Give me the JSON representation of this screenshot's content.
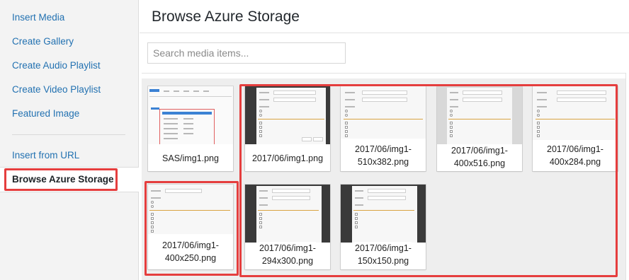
{
  "sidebar": {
    "items": [
      {
        "label": "Insert Media"
      },
      {
        "label": "Create Gallery"
      },
      {
        "label": "Create Audio Playlist"
      },
      {
        "label": "Create Video Playlist"
      },
      {
        "label": "Featured Image"
      }
    ],
    "secondary": [
      {
        "label": "Insert from URL"
      }
    ],
    "active": {
      "label": "Browse Azure Storage"
    }
  },
  "frame": {
    "title": "Browse Azure Storage",
    "search_placeholder": "Search media items..."
  },
  "media": [
    {
      "line1": "SAS/img1.png",
      "line2": ""
    },
    {
      "line1": "2017/06/img1.png",
      "line2": ""
    },
    {
      "line1": "2017/06/img1-",
      "line2": "510x382.png"
    },
    {
      "line1": "2017/06/img1-",
      "line2": "400x516.png"
    },
    {
      "line1": "2017/06/img1-",
      "line2": "400x284.png"
    },
    {
      "line1": "2017/06/img1-",
      "line2": "400x250.png"
    },
    {
      "line1": "2017/06/img1-",
      "line2": "294x300.png"
    },
    {
      "line1": "2017/06/img1-",
      "line2": "150x150.png"
    }
  ],
  "colors": {
    "link": "#2271b1",
    "highlight": "#e53e3e",
    "sidebar_bg": "#f3f3f3",
    "grid_bg": "#eeeeee"
  }
}
